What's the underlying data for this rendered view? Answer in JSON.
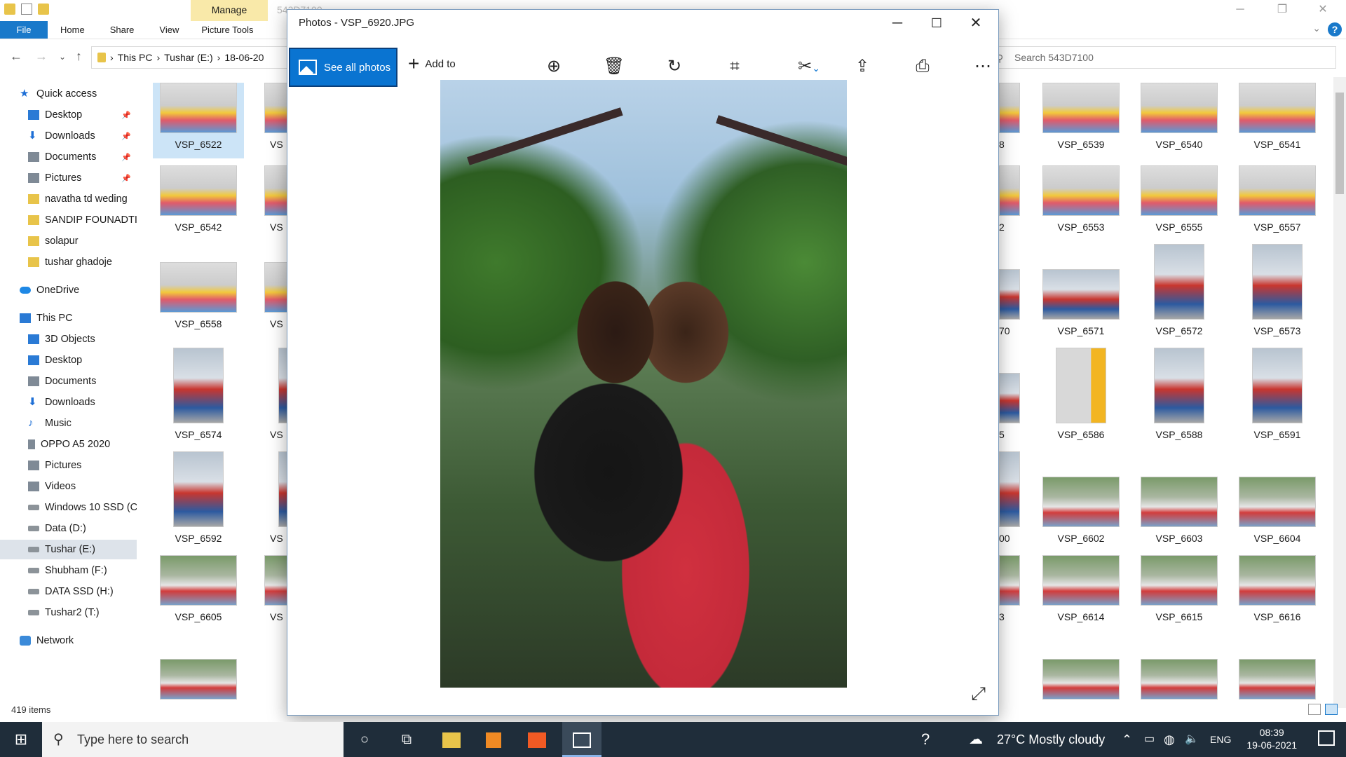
{
  "explorer": {
    "manage_tab": "Manage",
    "ghost_title": "543D7100",
    "ribbon": {
      "file": "File",
      "tabs": [
        "Home",
        "Share",
        "View",
        "Picture Tools"
      ]
    },
    "address": {
      "parts": [
        "This PC",
        "Tushar (E:)",
        "18-06-20"
      ]
    },
    "search_placeholder": "Search 543D7100",
    "nav": {
      "quick_access": "Quick access",
      "quick": [
        {
          "label": "Desktop",
          "icon": "desktop-icon"
        },
        {
          "label": "Downloads",
          "icon": "downloads-icon"
        },
        {
          "label": "Documents",
          "icon": "documents-icon"
        },
        {
          "label": "Pictures",
          "icon": "pictures-icon"
        },
        {
          "label": "navatha td weding",
          "icon": "folder-icon"
        },
        {
          "label": "SANDIP FOUNADTI(",
          "icon": "folder-icon"
        },
        {
          "label": "solapur",
          "icon": "folder-icon"
        },
        {
          "label": "tushar ghadoje",
          "icon": "folder-icon"
        }
      ],
      "onedrive": "OneDrive",
      "this_pc": "This PC",
      "pc": [
        {
          "label": "3D Objects"
        },
        {
          "label": "Desktop"
        },
        {
          "label": "Documents"
        },
        {
          "label": "Downloads"
        },
        {
          "label": "Music"
        },
        {
          "label": "OPPO A5 2020"
        },
        {
          "label": "Pictures"
        },
        {
          "label": "Videos"
        },
        {
          "label": "Windows 10 SSD (C"
        },
        {
          "label": "Data (D:)"
        },
        {
          "label": "Tushar (E:)"
        },
        {
          "label": "Shubham (F:)"
        },
        {
          "label": "DATA SSD (H:)"
        },
        {
          "label": "Tushar2 (T:)"
        }
      ],
      "network": "Network"
    },
    "status": "419 items",
    "thumbs": {
      "col1": [
        "VSP_6522",
        "VSP_6542",
        "VSP_6558",
        "VSP_6574",
        "VSP_6592",
        "VSP_6605"
      ],
      "col2": [
        "VS",
        "VS",
        "VS",
        "VS",
        "VS",
        "VS"
      ],
      "col3": [
        "8",
        "2",
        "70",
        "5",
        "00",
        "3"
      ],
      "col4": [
        "VSP_6539",
        "VSP_6553",
        "VSP_6571",
        "VSP_6586",
        "VSP_6602",
        "VSP_6614"
      ],
      "col5": [
        "VSP_6540",
        "VSP_6555",
        "VSP_6572",
        "VSP_6588",
        "VSP_6603",
        "VSP_6615"
      ],
      "col6": [
        "VSP_6541",
        "VSP_6557",
        "VSP_6573",
        "VSP_6591",
        "VSP_6604",
        "VSP_6616"
      ]
    }
  },
  "photos": {
    "title": "Photos - VSP_6920.JPG",
    "see_all": "See all photos",
    "add_to": "Add to",
    "toolbar_icons": [
      "zoom-in-icon",
      "delete-icon",
      "rotate-icon",
      "crop-icon",
      "edit-icon",
      "share-icon",
      "print-icon",
      "more-icon"
    ]
  },
  "taskbar": {
    "search_placeholder": "Type here to search",
    "weather": "27°C  Mostly cloudy",
    "lang": "ENG",
    "time": "08:39",
    "date": "19-06-2021"
  }
}
